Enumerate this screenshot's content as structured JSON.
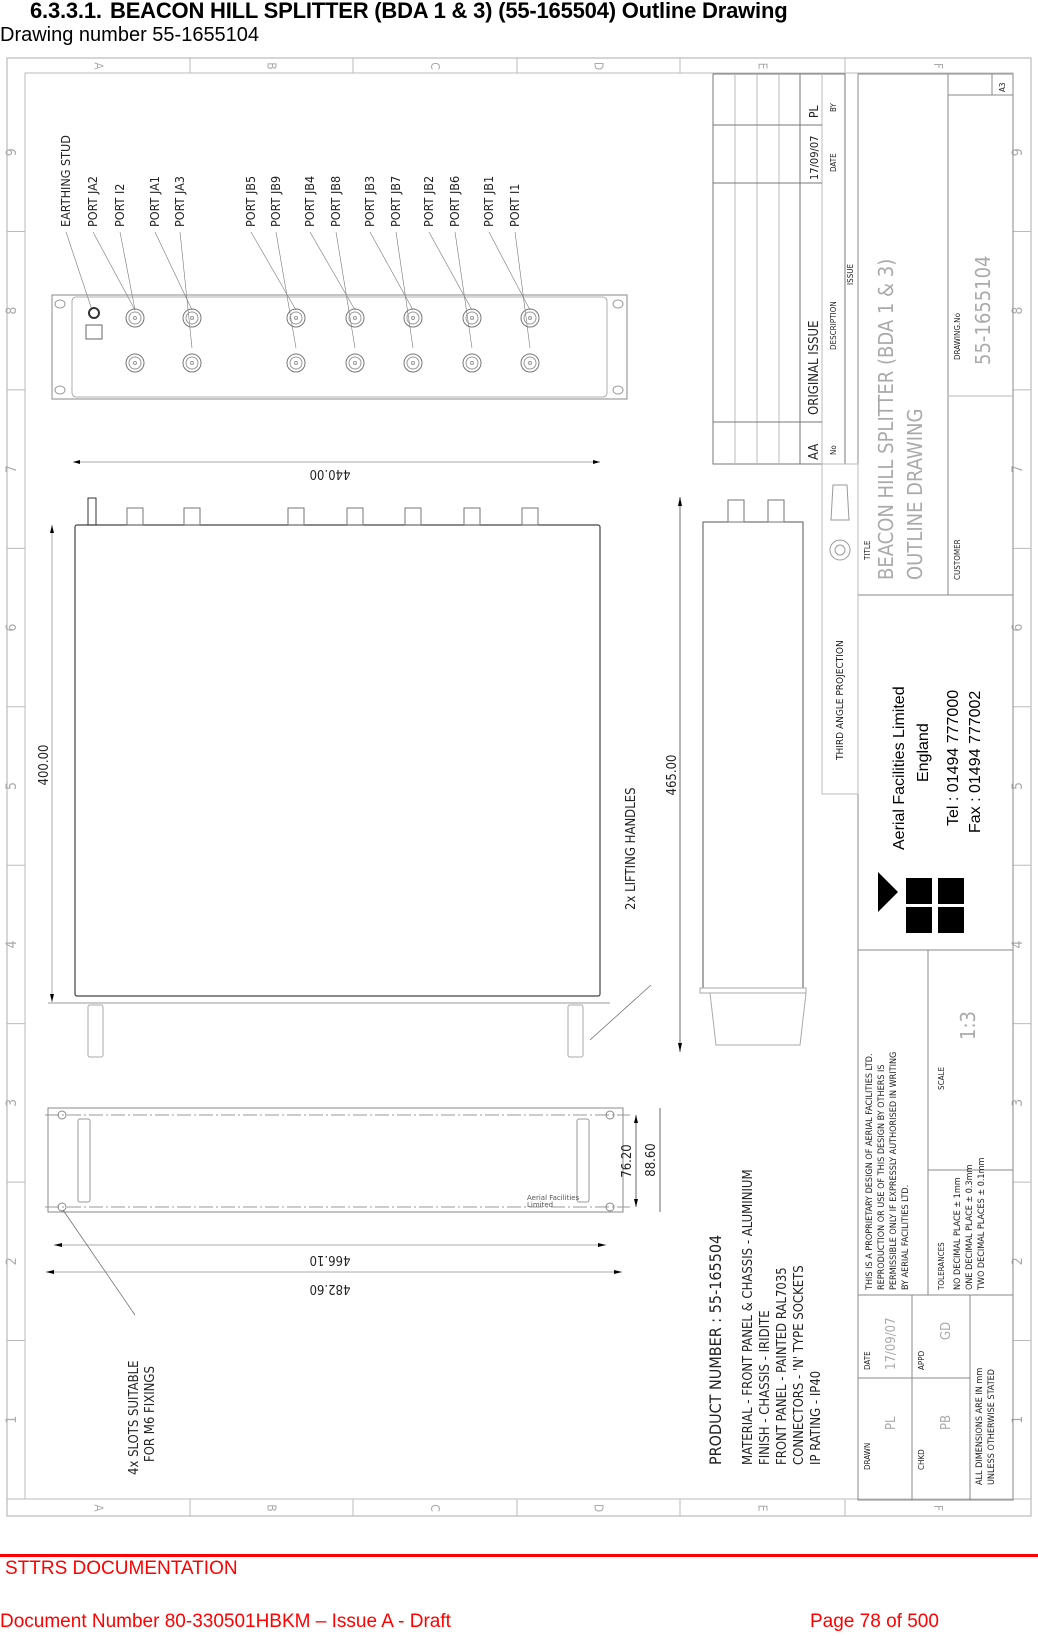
{
  "page": {
    "section_number": "6.3.3.1.",
    "section_title": "BEACON HILL SPLITTER (BDA 1 & 3) (55-165504) Outline Drawing",
    "subtitle": "Drawing number 55-1655104"
  },
  "footer": {
    "title": "STTRS DOCUMENTATION",
    "document_number": "Document Number 80-330501HBKM – Issue A - Draft",
    "page": "Page 78 of 500",
    "accent_color": "#ff0000"
  },
  "drawing": {
    "zone_columns": [
      "A",
      "B",
      "C",
      "D",
      "E",
      "F"
    ],
    "zone_rows": [
      "9",
      "8",
      "7",
      "6",
      "5",
      "4",
      "3",
      "2",
      "1"
    ],
    "port_labels": [
      "EARTHING STUD",
      "PORT JA2",
      "PORT I2",
      "PORT JA1",
      "PORT JA3",
      "PORT JB5",
      "PORT JB9",
      "PORT JB4",
      "PORT JB8",
      "PORT JB3",
      "PORT JB7",
      "PORT JB2",
      "PORT JB6",
      "PORT JB1",
      "PORT I1"
    ],
    "dimensions": {
      "width_top": "440.00",
      "depth_side": "400.00",
      "side_length": "465.00",
      "panel_width_inner": "466.10",
      "panel_width_outer": "482.60",
      "panel_height_inner": "76.20",
      "panel_height_outer": "88.60"
    },
    "annotations": {
      "lifting_handles": "2x LIFTING HANDLES",
      "slots_line1": "4x SLOTS SUITABLE",
      "slots_line2": "FOR M6 FIXINGS",
      "panel_logo_line1": "Aerial Facilities",
      "panel_logo_line2": "Limited"
    },
    "product": {
      "product_number": "PRODUCT NUMBER : 55-165504",
      "notes": [
        "MATERIAL - FRONT PANEL & CHASSIS - ALUMINIUM",
        "FINISH - CHASSIS - IRIDITE",
        "FRONT PANEL - PAINTED RAL7035",
        "CONNECTORS - 'N' TYPE SOCKETS",
        "IP RATING - IP40"
      ]
    },
    "revision_table": {
      "row": {
        "no": "AA",
        "description": "ORIGINAL ISSUE",
        "date": "17/09/07",
        "by": "PL"
      },
      "headers": {
        "no": "No",
        "description": "DESCRIPTION",
        "date": "DATE",
        "by": "BY"
      },
      "caption": "ISSUE"
    },
    "title_block": {
      "projection": "THIRD ANGLE PROJECTION",
      "title_label": "TITLE",
      "title_line1": "BEACON HILL SPLITTER (BDA 1 & 3)",
      "title_line2": "OUTLINE DRAWING",
      "customer_label": "CUSTOMER",
      "drawing_no_label": "DRAWING.No",
      "drawing_no": "55-1655104",
      "sheet_size": "A3",
      "company": "Aerial Facilities Limited",
      "country": "England",
      "tel": "Tel : 01494 777000",
      "fax": "Fax : 01494 777002",
      "proprietary": [
        "THIS IS A PROPRIETARY DESIGN OF AERIAL FACILITIES LTD.",
        "REPRODUCTION OR USE OF THIS DESIGN BY OTHERS IS",
        "PERMISSIBLE ONLY IF EXPRESSLY AUTHORISED IN WRITING",
        "BY AERIAL FACILITIES LTD."
      ],
      "scale_label": "SCALE",
      "scale": "1:3",
      "tolerances_label": "TOLERANCES",
      "tolerances": [
        "NO DECIMAL PLACE ± 1mm",
        "ONE DECIMAL PLACE ± 0.3mm",
        "TWO DECIMAL PLACES ± 0.1mm"
      ],
      "drawn_label": "DRAWN",
      "drawn": "PL",
      "date_label": "DATE",
      "date": "17/09/07",
      "chkd_label": "CHKD",
      "chkd": "PB",
      "appd_label": "APPD",
      "appd": "GD",
      "units_line1": "ALL DIMENSIONS ARE IN mm",
      "units_line2": "UNLESS OTHERWISE STATED"
    }
  }
}
